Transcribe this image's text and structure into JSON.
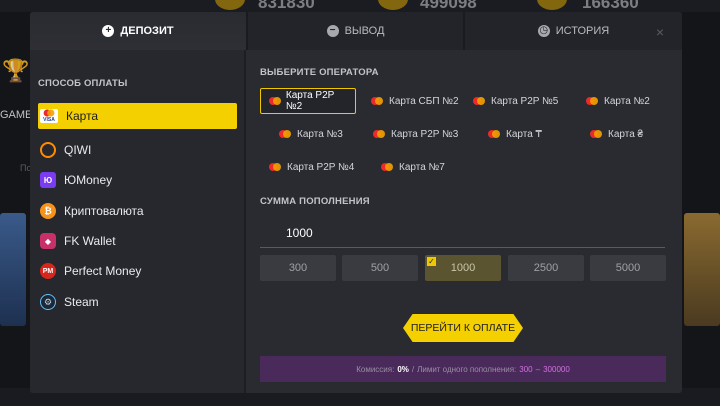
{
  "background": {
    "top_numbers": [
      "831830",
      "499098",
      "166360"
    ],
    "games_label": "GAME",
    "po_label": "По"
  },
  "tabs": [
    {
      "label": "ДЕПОЗИТ",
      "icon": "plus-circle-icon",
      "active": true
    },
    {
      "label": "ВЫВОД",
      "icon": "minus-circle-icon",
      "active": false
    },
    {
      "label": "ИСТОРИЯ",
      "icon": "clock-icon",
      "active": false
    }
  ],
  "close_icon": "×",
  "payment": {
    "title": "СПОСОБ ОПЛАТЫ",
    "methods": [
      {
        "label": "Карта",
        "icon": "visa-mastercard-icon",
        "selected": true
      },
      {
        "label": "QIWI",
        "icon": "qiwi-icon"
      },
      {
        "label": "ЮMoney",
        "icon": "yoomoney-icon"
      },
      {
        "label": "Криптовалюта",
        "icon": "bitcoin-icon"
      },
      {
        "label": "FK Wallet",
        "icon": "fk-wallet-icon"
      },
      {
        "label": "Perfect Money",
        "icon": "perfect-money-icon"
      },
      {
        "label": "Steam",
        "icon": "steam-icon"
      }
    ]
  },
  "operators": {
    "title": "ВЫБЕРИТЕ ОПЕРАТОРА",
    "items": [
      {
        "label": "Карта P2P №2",
        "selected": true
      },
      {
        "label": "Карта СБП №2"
      },
      {
        "label": "Карта P2P №5"
      },
      {
        "label": "Карта №2"
      },
      {
        "label": "Карта №3"
      },
      {
        "label": "Карта P2P №3"
      },
      {
        "label": "Карта ₸"
      },
      {
        "label": "Карта ₴"
      },
      {
        "label": "Карта P2P №4"
      },
      {
        "label": "Карта №7"
      }
    ]
  },
  "amount": {
    "title": "СУММА ПОПОЛНЕНИЯ",
    "value": "1000",
    "presets": [
      "300",
      "500",
      "1000",
      "2500",
      "5000"
    ],
    "selected_preset": "1000"
  },
  "pay_button": "ПЕРЕЙТИ К ОПЛАТЕ",
  "info": {
    "commission_label": "Комиссия:",
    "commission_value": "0%",
    "separator": "/",
    "limit_label": "Лимит одного пополнения:",
    "limit_min": "300",
    "limit_dash": "–",
    "limit_max": "300000"
  },
  "colors": {
    "accent": "#f5d000",
    "modal_bg": "#2a2b31",
    "info_bar": "#4a2a5a"
  }
}
